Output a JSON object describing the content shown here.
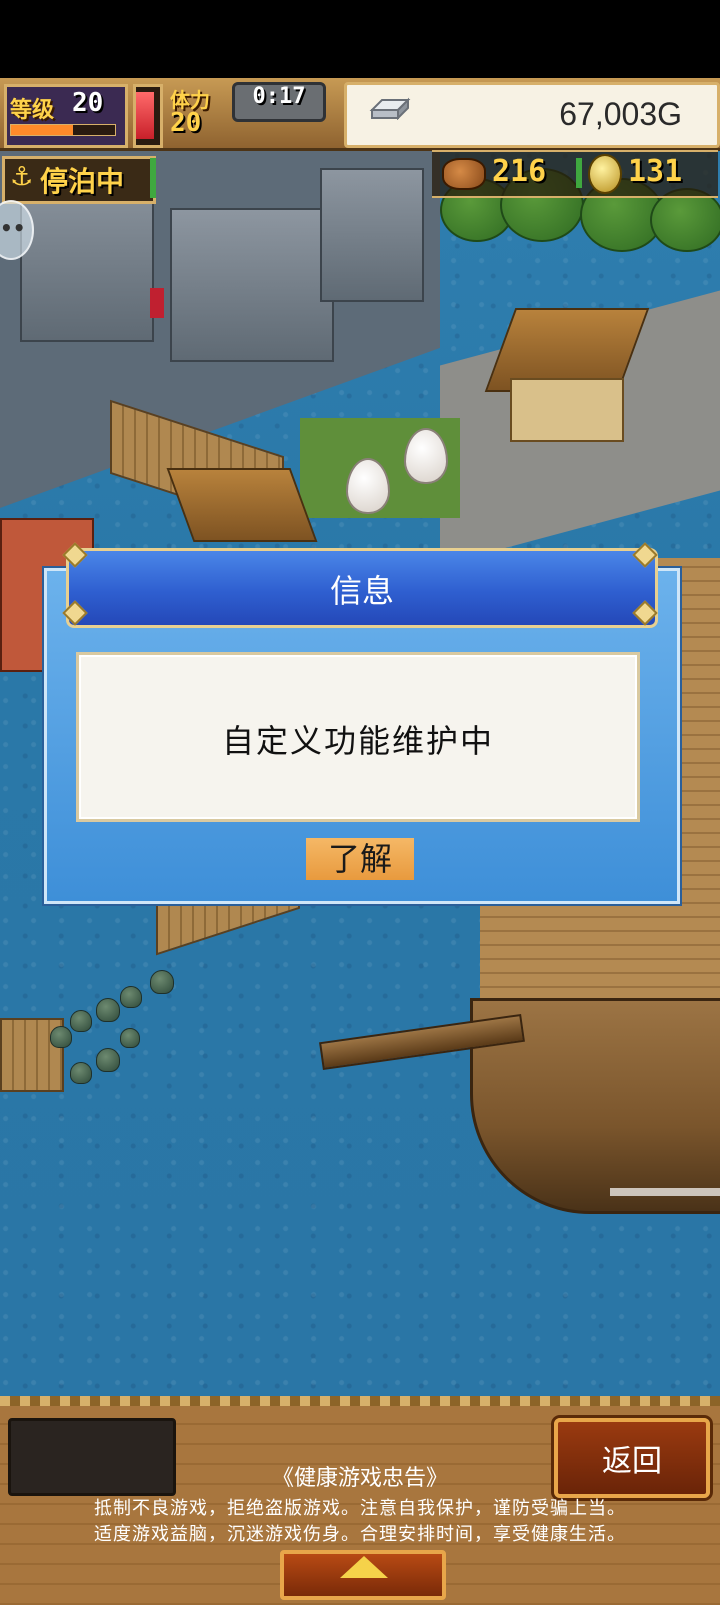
{
  "hud": {
    "level_label": "等级",
    "level_value": "20",
    "level_exp_fraction": 0.6,
    "stamina_label": "体力",
    "stamina_value": "20",
    "stamina_fraction": 0.9,
    "timer": "0:17",
    "gold": "67,003G",
    "docked_label": "停泊中",
    "docked_icon": "⚓",
    "food_count": "216",
    "coin_count": "131"
  },
  "dialog": {
    "title": "信息",
    "message": "自定义功能维护中",
    "ok_label": "了解"
  },
  "bottom": {
    "return_label": "返回",
    "advisory_title": "《健康游戏忠告》",
    "advisory_line1": "抵制不良游戏，拒绝盗版游戏。注意自我保护，谨防受骗上当。",
    "advisory_line2": "适度游戏益脑，沉迷游戏伤身。合理安排时间，享受健康生活。"
  },
  "icons": {
    "silver": "silver-ingot-icon",
    "food": "meat-icon",
    "coin": "medal-coin-icon",
    "anchor": "anchor-icon",
    "chat": "chat-bubble-icon",
    "expand": "up-arrow-icon"
  },
  "colors": {
    "dialog_header": "#2f5fd0",
    "dialog_body": "#4a9ae0",
    "ok_button": "#f0a850",
    "hud_gold_text": "#ffd24a",
    "water": "#2a78a8"
  }
}
